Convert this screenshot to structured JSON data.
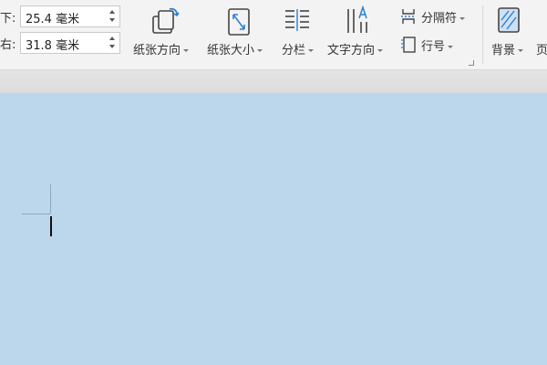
{
  "margins": {
    "bottom": {
      "label": "下:",
      "value": "25.4 毫米"
    },
    "right": {
      "label": "右:",
      "value": "31.8 毫米"
    }
  },
  "ribbon": {
    "orientation_label": "纸张方向",
    "size_label": "纸张大小",
    "columns_label": "分栏",
    "text_direction_label": "文字方向",
    "breaks_label": "分隔符",
    "line_numbers_label": "行号",
    "background_label": "背景",
    "page_border_label": "页"
  },
  "colors": {
    "ribbon_bg": "#f3f3f3",
    "document_bg": "#bcd7ec",
    "icon_accent": "#2a7fd4",
    "background_icon_fill": "#cfe0f3"
  },
  "icons": [
    "paper-orientation-icon",
    "paper-size-icon",
    "columns-icon",
    "text-direction-icon",
    "breaks-icon",
    "line-numbers-icon",
    "background-icon"
  ]
}
